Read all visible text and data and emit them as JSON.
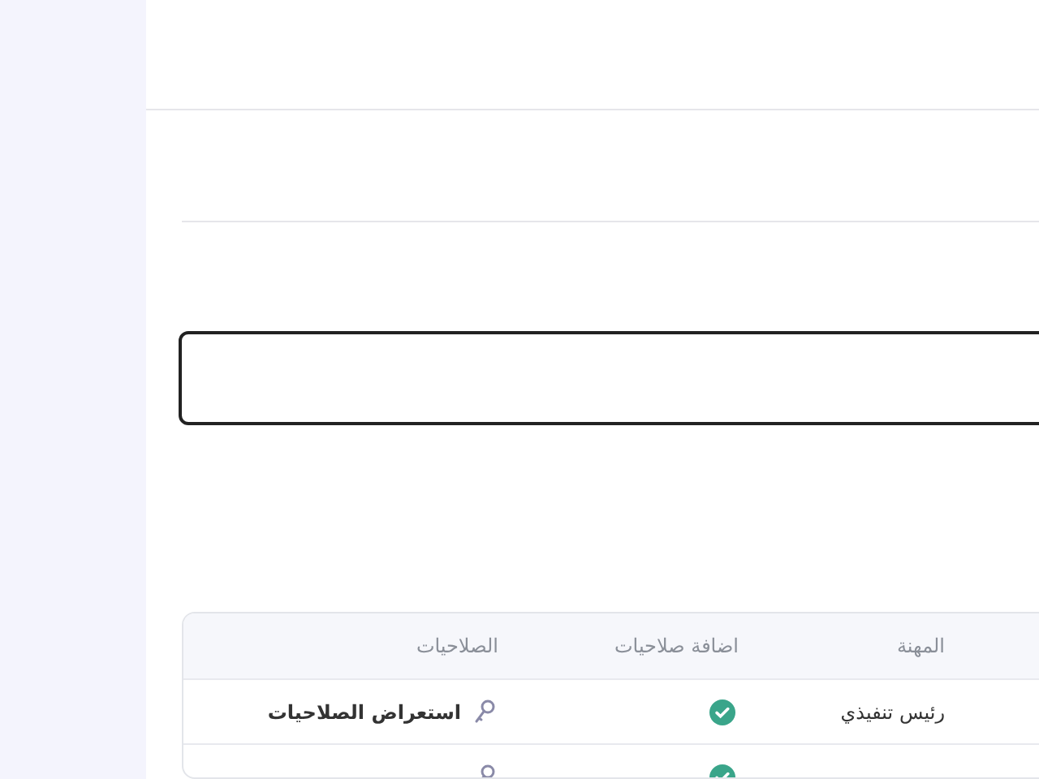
{
  "table": {
    "columns": [
      "المهنة",
      "اضافة صلاحيات",
      "الصلاحيات"
    ],
    "rows": [
      {
        "job": "رئيس تنفيذي",
        "add_permission": true,
        "permissions_link": "استعراض الصلاحيات"
      },
      {
        "add_permission": true
      }
    ]
  }
}
